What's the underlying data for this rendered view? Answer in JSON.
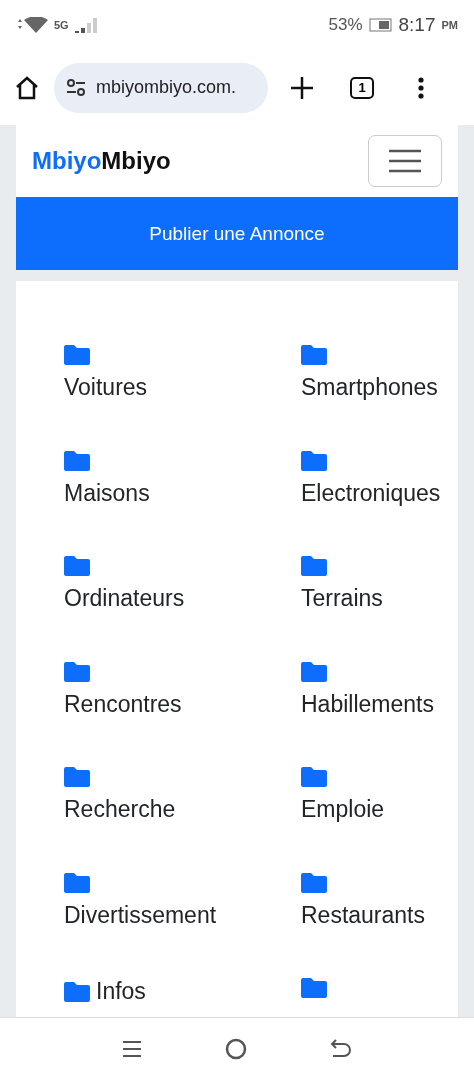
{
  "status_bar": {
    "network": "5G",
    "battery": "53%",
    "time": "8:17",
    "period": "PM"
  },
  "browser": {
    "url": "mbiyombiyo.com.",
    "tab_count": "1"
  },
  "navbar": {
    "brand": [
      {
        "text": "Mbiyo",
        "color": "#0d6efd"
      },
      {
        "text": "Mbiyo",
        "color": "#111111"
      }
    ]
  },
  "banner": {
    "label": "Publier une Annonce"
  },
  "categories": [
    {
      "label": "Voitures",
      "kind": "stacked"
    },
    {
      "label": "Smartphones",
      "kind": "stacked"
    },
    {
      "label": "Maisons",
      "kind": "stacked"
    },
    {
      "label": "Electroniques",
      "kind": "stacked"
    },
    {
      "label": "Ordinateurs",
      "kind": "stacked"
    },
    {
      "label": "Terrains",
      "kind": "stacked"
    },
    {
      "label": "Rencontres",
      "kind": "stacked"
    },
    {
      "label": "Habillements",
      "kind": "stacked"
    },
    {
      "label": "Recherche",
      "kind": "stacked"
    },
    {
      "label": "Emploie",
      "kind": "stacked"
    },
    {
      "label": "Divertissement",
      "kind": "stacked"
    },
    {
      "label": "Restaurants",
      "kind": "stacked"
    },
    {
      "label": "Infos",
      "kind": "inline"
    },
    {
      "kind": "stacked"
    }
  ]
}
